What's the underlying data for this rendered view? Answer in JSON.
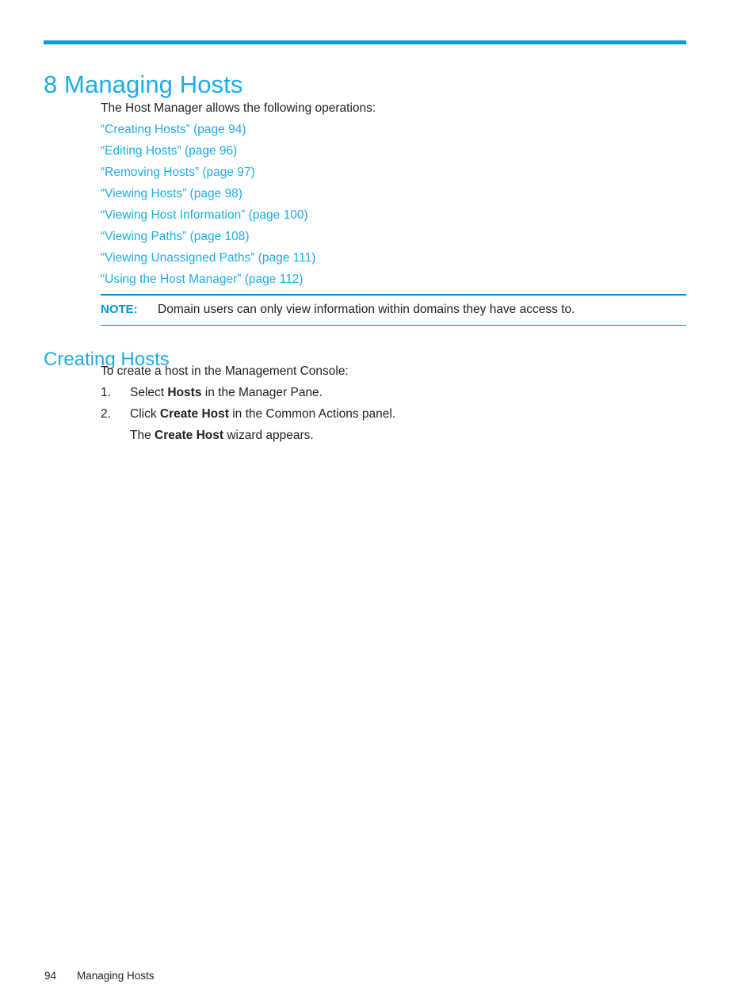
{
  "page": {
    "chapter_number": "8",
    "chapter_title": "8 Managing Hosts",
    "rule_color": "#0c9bd7",
    "heading_color": "#1badea",
    "link_color": "#1badea",
    "note_label_color": "#0096d6",
    "text_color": "#231f20"
  },
  "intro": {
    "line": "The Host Manager allows the following operations:"
  },
  "cross_references": [
    {
      "title": "“Creating Hosts”",
      "page_ref": "(page 94)",
      "full": "“Creating Hosts” (page 94)"
    },
    {
      "title": "“Editing Hosts”",
      "page_ref": "(page 96)",
      "full": "“Editing Hosts” (page 96)"
    },
    {
      "title": "“Removing Hosts”",
      "page_ref": "(page 97)",
      "full": "“Removing Hosts” (page 97)"
    },
    {
      "title": "“Viewing Hosts”",
      "page_ref": "(page 98)",
      "full": "“Viewing Hosts” (page 98)"
    },
    {
      "title": "“Viewing Host Information”",
      "page_ref": "(page 100)",
      "full": "“Viewing Host Information” (page 100)"
    },
    {
      "title": "“Viewing Paths”",
      "page_ref": "(page 108)",
      "full": "“Viewing Paths” (page 108)"
    },
    {
      "title": "“Viewing Unassigned Paths”",
      "page_ref": "(page 111)",
      "full": "“Viewing Unassigned Paths” (page 111)"
    },
    {
      "title": "“Using the Host Manager”",
      "page_ref": "(page 112)",
      "full": "“Using the Host Manager” (page 112)"
    }
  ],
  "note": {
    "label": "NOTE:",
    "text": "Domain users can only view information within domains they have access to."
  },
  "section": {
    "heading": "Creating Hosts",
    "intro": "To create a host in the Management Console:",
    "steps": [
      {
        "number": "1.",
        "parts": [
          {
            "text": "Select ",
            "bold": false
          },
          {
            "text": "Hosts",
            "bold": true
          },
          {
            "text": " in the Manager Pane.",
            "bold": false
          }
        ]
      },
      {
        "number": "2.",
        "parts": [
          {
            "text": "Click ",
            "bold": false
          },
          {
            "text": "Create Host",
            "bold": true
          },
          {
            "text": " in the Common Actions panel.",
            "bold": false
          }
        ]
      }
    ],
    "continuation": {
      "parts": [
        {
          "text": "The ",
          "bold": false
        },
        {
          "text": "Create Host",
          "bold": true
        },
        {
          "text": " wizard appears.",
          "bold": false
        }
      ]
    }
  },
  "footer": {
    "page_number": "94",
    "chapter_label": "Managing Hosts"
  }
}
